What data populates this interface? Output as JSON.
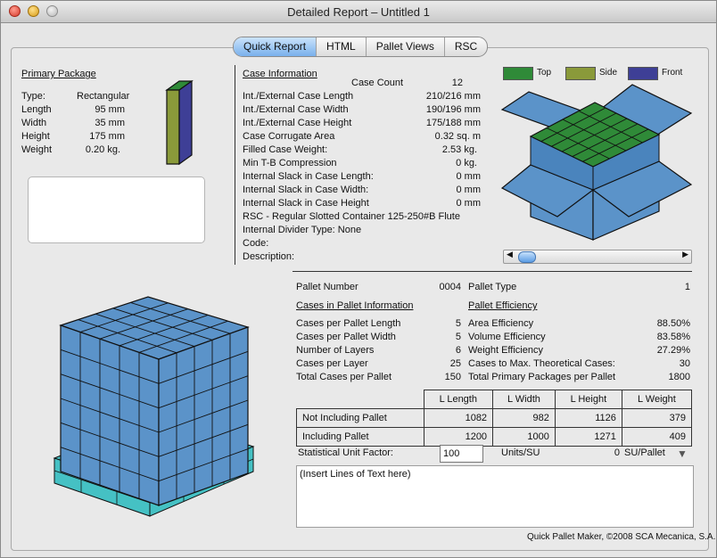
{
  "window": {
    "title": "Detailed Report – Untitled 1"
  },
  "tabs": [
    "Quick Report",
    "HTML",
    "Pallet Views",
    "RSC"
  ],
  "primary_package": {
    "heading": "Primary Package",
    "rows": [
      {
        "label": "Type:",
        "value": "Rectangular"
      },
      {
        "label": "Length",
        "value": "95 mm"
      },
      {
        "label": "Width",
        "value": "35 mm"
      },
      {
        "label": "Height",
        "value": "175 mm"
      },
      {
        "label": "Weight",
        "value": "0.20 kg."
      }
    ]
  },
  "case_info": {
    "heading": "Case Information",
    "count_label": "Case Count",
    "count_value": "12",
    "rows": [
      {
        "label": "Int./External Case Length",
        "value": "210/216 mm"
      },
      {
        "label": "Int./External Case Width",
        "value": "190/196 mm"
      },
      {
        "label": "Int./External Case Height",
        "value": "175/188 mm"
      },
      {
        "label": "Case Corrugate Area",
        "value": "0.32 sq. m"
      },
      {
        "label": "Filled Case Weight:",
        "value": "2.53 kg."
      },
      {
        "label": "Min T-B Compression",
        "value": "0 kg."
      },
      {
        "label": "Internal Slack in Case Length:",
        "value": "0 mm"
      },
      {
        "label": "Internal Slack in Case Width:",
        "value": "0 mm"
      },
      {
        "label": "Internal Slack in Case Height",
        "value": "0 mm"
      }
    ],
    "rsc_line": "RSC - Regular Slotted Container 125-250#B Flute",
    "divider_line": "Internal Divider Type: None",
    "code_label": "Code:",
    "description_label": "Description:"
  },
  "legend": [
    {
      "label": "Top",
      "color": "#2f8a38"
    },
    {
      "label": "Side",
      "color": "#8a9a3a"
    },
    {
      "label": "Front",
      "color": "#3e3f96"
    }
  ],
  "pallet": {
    "number_label": "Pallet Number",
    "number_value": "0004",
    "type_label": "Pallet Type",
    "type_value": "1",
    "cases_heading": "Cases in Pallet Information",
    "efficiency_heading": "Pallet Efficiency",
    "cases_rows": [
      {
        "label": "Cases per Pallet Length",
        "value": "5"
      },
      {
        "label": "Cases per Pallet Width",
        "value": "5"
      },
      {
        "label": "Number of Layers",
        "value": "6"
      },
      {
        "label": "Cases per Layer",
        "value": "25"
      },
      {
        "label": "Total Cases per Pallet",
        "value": "150"
      }
    ],
    "efficiency_rows": [
      {
        "label": "Area Efficiency",
        "value": "88.50%"
      },
      {
        "label": "Volume Efficiency",
        "value": "83.58%"
      },
      {
        "label": "Weight Efficiency",
        "value": "27.29%"
      },
      {
        "label": "Cases to Max. Theoretical Cases:",
        "value": "30"
      },
      {
        "label": "Total Primary Packages per Pallet",
        "value": "1800"
      }
    ]
  },
  "dims_table": {
    "headers": [
      "L Length",
      "L Width",
      "L Height",
      "L Weight"
    ],
    "rows": [
      {
        "label": "Not Including Pallet",
        "values": [
          "1082",
          "982",
          "1126",
          "379"
        ]
      },
      {
        "label": "Including Pallet",
        "values": [
          "1200",
          "1000",
          "1271",
          "409"
        ]
      }
    ]
  },
  "stat": {
    "label": "Statistical Unit Factor:",
    "input_value": "100",
    "units_label": "Units/SU",
    "su_value": "0",
    "su_label": "SU/Pallet"
  },
  "notes": {
    "text": "(Insert Lines of Text here)"
  },
  "footer": {
    "copyright": "Quick Pallet Maker, ©2008 SCA Mecanica, S.A."
  }
}
